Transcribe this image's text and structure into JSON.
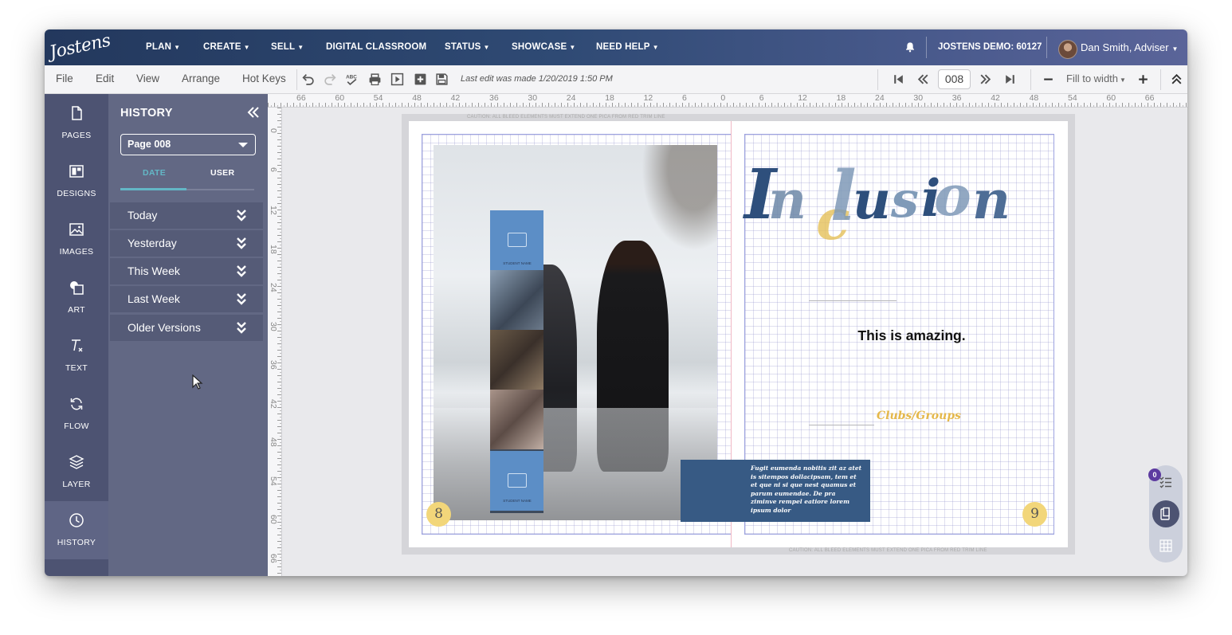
{
  "app": {
    "logo_text": "Jostens"
  },
  "topnav": {
    "items": [
      {
        "label": "PLAN",
        "caret": true
      },
      {
        "label": "CREATE",
        "caret": true
      },
      {
        "label": "SELL",
        "caret": true
      },
      {
        "label": "DIGITAL CLASSROOM",
        "caret": false
      },
      {
        "label": "STATUS",
        "caret": true
      },
      {
        "label": "SHOWCASE",
        "caret": true
      },
      {
        "label": "NEED HELP",
        "caret": true
      }
    ],
    "account": "JOSTENS DEMO: 60127",
    "user": "Dan Smith, Adviser",
    "icons": [
      "bell-icon",
      "avatar",
      "chevron-down-icon"
    ]
  },
  "toolbar": {
    "menus": [
      "File",
      "Edit",
      "View",
      "Arrange",
      "Hot Keys"
    ],
    "tools": [
      "undo-icon",
      "redo-icon",
      "spellcheck-icon",
      "print-icon",
      "preview-icon",
      "add-page-icon",
      "save-icon"
    ],
    "last_edit": "Last edit was made 1/20/2019 1:50 PM",
    "page_number": "008",
    "zoom_label": "Fill to width",
    "nav_icons": [
      "first-page-icon",
      "prev-page-icon",
      "next-page-icon",
      "last-page-icon",
      "zoom-out-icon",
      "zoom-in-icon",
      "collapse-toolbar-icon"
    ]
  },
  "rail": {
    "items": [
      {
        "label": "PAGES",
        "icon": "pages-icon",
        "active": false
      },
      {
        "label": "DESIGNS",
        "icon": "designs-icon",
        "active": false
      },
      {
        "label": "IMAGES",
        "icon": "images-icon",
        "active": false
      },
      {
        "label": "ART",
        "icon": "art-icon",
        "active": false
      },
      {
        "label": "TEXT",
        "icon": "text-clear-icon",
        "active": false
      },
      {
        "label": "FLOW",
        "icon": "flow-icon",
        "active": false
      },
      {
        "label": "LAYER",
        "icon": "layers-icon",
        "active": false
      },
      {
        "label": "HISTORY",
        "icon": "clock-icon",
        "active": true
      }
    ]
  },
  "history": {
    "title": "HISTORY",
    "page_select": "Page 008",
    "tabs": [
      {
        "label": "DATE",
        "active": true
      },
      {
        "label": "USER",
        "active": false
      }
    ],
    "groups": [
      "Today",
      "Yesterday",
      "This Week",
      "Last Week",
      "Older Versions"
    ]
  },
  "ruler": {
    "top": [
      "66",
      "60",
      "54",
      "48",
      "42",
      "36",
      "30",
      "24",
      "18",
      "12",
      "6",
      "0",
      "6",
      "12",
      "18",
      "24",
      "30",
      "36",
      "42",
      "48",
      "54",
      "60",
      "66"
    ],
    "left": [
      "0",
      "6",
      "12",
      "18",
      "24",
      "30",
      "36",
      "42",
      "48",
      "54",
      "60",
      "66"
    ]
  },
  "spread": {
    "caution_top": "CAUTION: ALL BLEED ELEMENTS MUST EXTEND ONE PICA FROM RED TRIM LINE",
    "caution_bottom": "CAUTION: ALL BLEED ELEMENTS MUST EXTEND ONE PICA FROM RED TRIM LINE",
    "left_page_number": "8",
    "right_page_number": "9",
    "student_name": "STUDENT NAME",
    "caption": "Fugit eumenda nobitis zit az atet is sitempos dollacipsam, tem et et que ni si que nest quamus et parum eumendae. De pra ziminve rempel eatiore lorem ipsum dolor",
    "headline_letters": [
      "I",
      "n",
      "c",
      "l",
      "u",
      "s",
      "i",
      "o",
      "n"
    ],
    "subhead": "This is amazing.",
    "section_label": "Clubs/Groups"
  },
  "widget": {
    "badge_count": "0",
    "icons": [
      "checklist-icon",
      "clipboard-icon",
      "grid-icon"
    ]
  },
  "colors": {
    "nav_start": "#23385d",
    "nav_end": "#5a6499",
    "rail": "#4d5372",
    "panel": "#626884",
    "accent": "#63b7c6",
    "headline_blue": "#2e4f7c",
    "headline_gold": "#e6c15a",
    "caption_bg": "#375a84"
  }
}
